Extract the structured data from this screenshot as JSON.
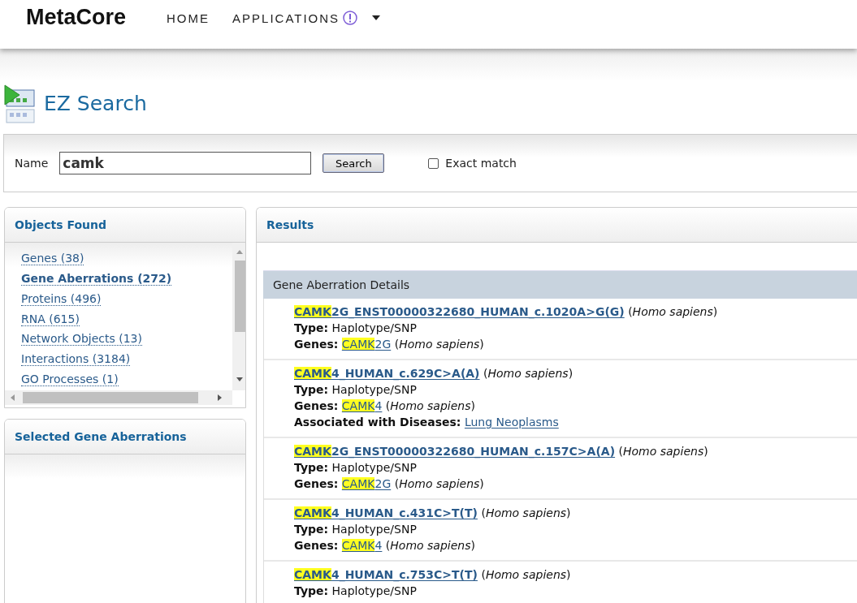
{
  "header": {
    "logo": "MetaCore",
    "nav": [
      {
        "label": "HOME",
        "alert": false,
        "dropdown": false
      },
      {
        "label": "APPLICATIONS",
        "alert": true,
        "dropdown": true
      }
    ]
  },
  "page_title": "EZ Search",
  "search": {
    "label": "Name",
    "value": "camk",
    "button": "Search",
    "exact_match": {
      "label": "Exact match",
      "checked": false
    }
  },
  "objects_found": {
    "title": "Objects Found",
    "items": [
      {
        "label": "Genes (38)",
        "selected": false
      },
      {
        "label": "Gene Aberrations (272)",
        "selected": true
      },
      {
        "label": "Proteins (496)",
        "selected": false
      },
      {
        "label": "RNA (615)",
        "selected": false
      },
      {
        "label": "Network Objects (13)",
        "selected": false
      },
      {
        "label": "Interactions (3184)",
        "selected": false
      },
      {
        "label": "GO Processes (1)",
        "selected": false
      }
    ]
  },
  "selected_panel": {
    "title": "Selected Gene Aberrations"
  },
  "results": {
    "title": "Results",
    "section": "Gene Aberration Details",
    "rows": [
      {
        "match": "CAMK",
        "rest": "2G_ENST00000322680_HUMAN_c.1020A>G(G)",
        "species": "(*Homo sapiens*)",
        "lines": [
          {
            "kind": "text",
            "label": "Type:",
            "value": "Haplotype/SNP"
          },
          {
            "kind": "gene",
            "label": "Genes:",
            "match": "CAMK",
            "rest": "2G",
            "species": "(*Homo sapiens*)"
          }
        ]
      },
      {
        "match": "CAMK",
        "rest": "4_HUMAN_c.629C>A(A)",
        "species": "(*Homo sapiens*)",
        "lines": [
          {
            "kind": "text",
            "label": "Type:",
            "value": "Haplotype/SNP"
          },
          {
            "kind": "gene",
            "label": "Genes:",
            "match": "CAMK",
            "rest": "4",
            "species": "(*Homo sapiens*)"
          },
          {
            "kind": "link",
            "label": "Associated with Diseases:",
            "value": "Lung Neoplasms"
          }
        ]
      },
      {
        "match": "CAMK",
        "rest": "2G_ENST00000322680_HUMAN_c.157C>A(A)",
        "species": "(*Homo sapiens*)",
        "lines": [
          {
            "kind": "text",
            "label": "Type:",
            "value": "Haplotype/SNP"
          },
          {
            "kind": "gene",
            "label": "Genes:",
            "match": "CAMK",
            "rest": "2G",
            "species": "(*Homo sapiens*)"
          }
        ]
      },
      {
        "match": "CAMK",
        "rest": "4_HUMAN_c.431C>T(T)",
        "species": "(*Homo sapiens*)",
        "lines": [
          {
            "kind": "text",
            "label": "Type:",
            "value": "Haplotype/SNP"
          },
          {
            "kind": "gene",
            "label": "Genes:",
            "match": "CAMK",
            "rest": "4",
            "species": "(*Homo sapiens*)"
          }
        ]
      },
      {
        "match": "CAMK",
        "rest": "4_HUMAN_c.753C>T(T)",
        "species": "(*Homo sapiens*)",
        "lines": [
          {
            "kind": "text",
            "label": "Type:",
            "value": "Haplotype/SNP"
          }
        ]
      }
    ]
  }
}
